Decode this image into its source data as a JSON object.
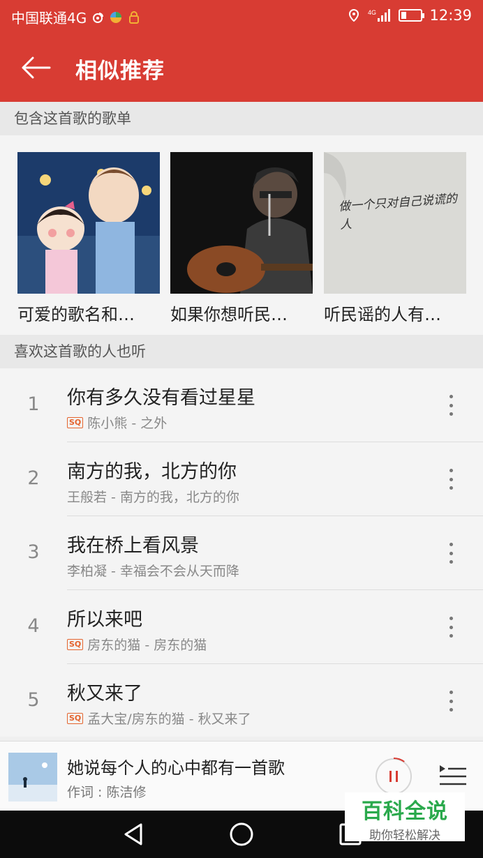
{
  "status_bar": {
    "carrier": "中国联通4G",
    "network": "4G",
    "time": "12:39"
  },
  "header": {
    "title": "相似推荐",
    "back_icon": "arrow-left-icon"
  },
  "sections": {
    "playlists_header": "包含这首歌的歌单",
    "listeners_header": "喜欢这首歌的人也听"
  },
  "playlists": [
    {
      "name": "可爱的歌名和…"
    },
    {
      "name": "如果你想听民…"
    },
    {
      "name": "听民谣的人有…"
    }
  ],
  "playlist_cover_text": "做一个只对自己说谎的人",
  "songs": [
    {
      "index": "1",
      "title": "你有多久没有看过星星",
      "sq": true,
      "subtitle": "陈小熊 - 之外"
    },
    {
      "index": "2",
      "title": "南方的我，北方的你",
      "sq": false,
      "subtitle": "王般若 - 南方的我，北方的你"
    },
    {
      "index": "3",
      "title": "我在桥上看风景",
      "sq": false,
      "subtitle": "李柏凝 - 幸福会不会从天而降"
    },
    {
      "index": "4",
      "title": "所以来吧",
      "sq": true,
      "subtitle": "房东的猫 - 房东的猫"
    },
    {
      "index": "5",
      "title": "秋又来了",
      "sq": true,
      "subtitle": "孟大宝/房东的猫 - 秋又来了"
    }
  ],
  "sq_label": "SQ",
  "player": {
    "title": "她说每个人的心中都有一首歌",
    "subtitle": "作词 : 陈洁修",
    "progress": 0.1
  },
  "watermark": {
    "title": "百科全说",
    "subtitle": "助你轻松解决"
  },
  "colors": {
    "brand": "#d83c33",
    "sq_badge": "#e4642e",
    "watermark": "#2aa94c"
  }
}
